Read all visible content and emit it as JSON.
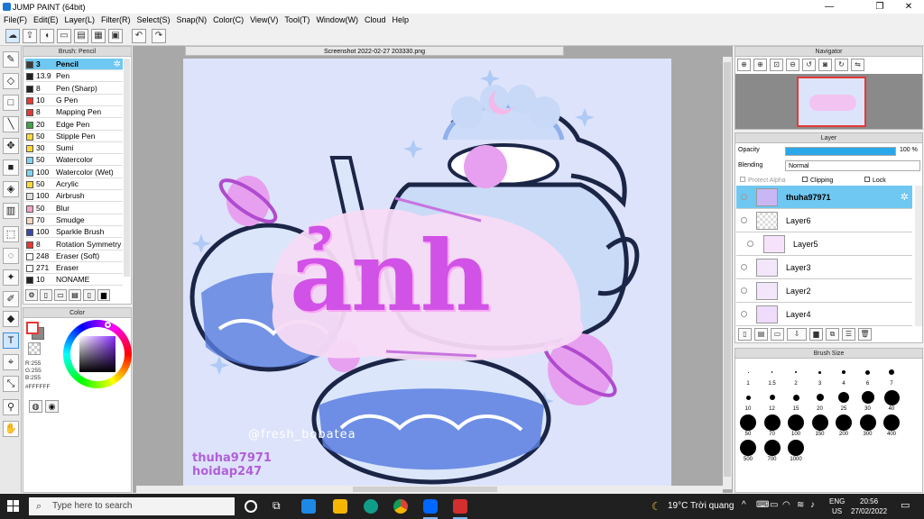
{
  "window": {
    "title": "JUMP PAINT (64bit)",
    "min": "—",
    "max": "❐",
    "close": "✕"
  },
  "menu": [
    "File(F)",
    "Edit(E)",
    "Layer(L)",
    "Filter(R)",
    "Select(S)",
    "Snap(N)",
    "Color(C)",
    "View(V)",
    "Tool(T)",
    "Window(W)",
    "Cloud",
    "Help"
  ],
  "brush_panel": {
    "title": "Brush: Pencil",
    "items": [
      {
        "size": "3",
        "name": "Pencil",
        "color": "#3a3a3a"
      },
      {
        "size": "13.9",
        "name": "Pen",
        "color": "#222222"
      },
      {
        "size": "8",
        "name": "Pen (Sharp)",
        "color": "#222222"
      },
      {
        "size": "10",
        "name": "G Pen",
        "color": "#e53935"
      },
      {
        "size": "8",
        "name": "Mapping Pen",
        "color": "#e53935"
      },
      {
        "size": "20",
        "name": "Edge Pen",
        "color": "#43a047"
      },
      {
        "size": "50",
        "name": "Stipple Pen",
        "color": "#fdd835"
      },
      {
        "size": "30",
        "name": "Sumi",
        "color": "#fdd835"
      },
      {
        "size": "50",
        "name": "Watercolor",
        "color": "#7fd3f0"
      },
      {
        "size": "100",
        "name": "Watercolor (Wet)",
        "color": "#7fd3f0"
      },
      {
        "size": "50",
        "name": "Acrylic",
        "color": "#fdd835"
      },
      {
        "size": "100",
        "name": "Airbrush",
        "color": "#e0e0e0"
      },
      {
        "size": "50",
        "name": "Blur",
        "color": "#f5a3c7"
      },
      {
        "size": "70",
        "name": "Smudge",
        "color": "#f6d5bd"
      },
      {
        "size": "100",
        "name": "Sparkle Brush",
        "color": "#3949ab"
      },
      {
        "size": "8",
        "name": "Rotation Symmetry",
        "color": "#e53935"
      },
      {
        "size": "248",
        "name": "Eraser (Soft)",
        "color": "#ffffff"
      },
      {
        "size": "271",
        "name": "Eraser",
        "color": "#ffffff"
      },
      {
        "size": "10",
        "name": "NONAME",
        "color": "#222222"
      }
    ]
  },
  "color_panel": {
    "title": "Color",
    "r": "R:255",
    "g": "G:255",
    "b": "B:255",
    "hex": "#FFFFFF"
  },
  "canvas": {
    "tab": "Screenshot 2022-02-27 203330.png",
    "word": "ảnh",
    "sig1": "thuha97971",
    "sig2": "hoidap247",
    "watermark": "@fresh_bobatea"
  },
  "navigator": {
    "title": "Navigator"
  },
  "layer_panel": {
    "title": "Layer",
    "opacity_label": "Opacity",
    "opacity_value": "100 %",
    "opacity_level": 1.0,
    "blending_label": "Blending",
    "blending_value": "Normal",
    "protect_alpha": "Protect Alpha",
    "clipping": "Clipping",
    "lock": "Lock",
    "layers": [
      "thuha97971",
      "Layer6",
      "Layer5",
      "Layer3",
      "Layer2",
      "Layer4"
    ]
  },
  "brush_size": {
    "title": "Brush Size",
    "sizes": [
      "1",
      "1.5",
      "2",
      "3",
      "4",
      "6",
      "7",
      "10",
      "12",
      "15",
      "20",
      "25",
      "30",
      "40",
      "50",
      "70",
      "100",
      "150",
      "200",
      "300",
      "400",
      "500",
      "700",
      "1000"
    ]
  },
  "taskbar": {
    "search": "Type here to search",
    "weather": "19°C Trời quang",
    "lang1": "ENG",
    "lang2": "US",
    "time": "20:56",
    "date": "27/02/2022"
  }
}
